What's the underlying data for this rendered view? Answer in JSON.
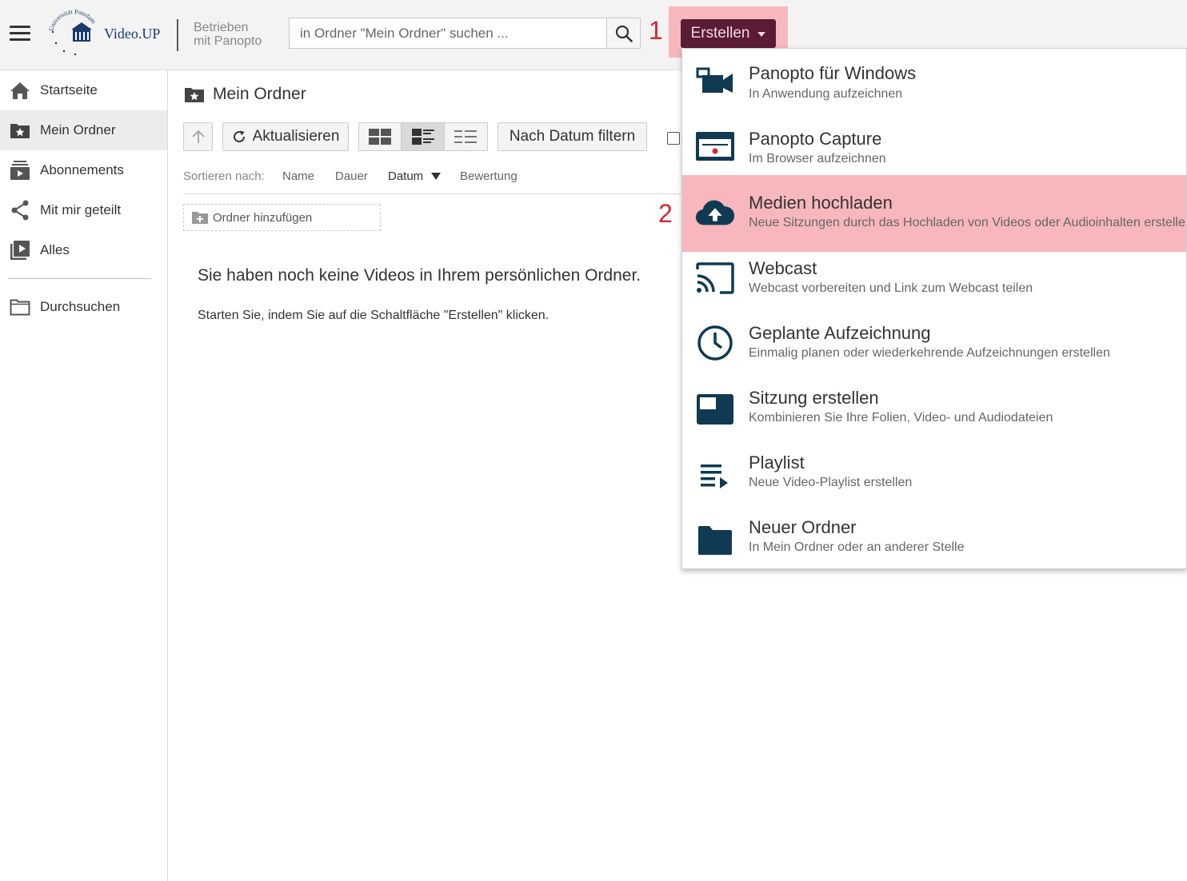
{
  "header": {
    "logo_text": "Video.UP",
    "logo_ring_text": "Universität Potsdam",
    "powered_line1": "Betrieben",
    "powered_line2": "mit Panopto",
    "search_placeholder": "in Ordner \"Mein Ordner\" suchen ...",
    "create_label": "Erstellen",
    "step1": "1",
    "step2": "2"
  },
  "sidebar": {
    "items": [
      {
        "label": "Startseite",
        "icon": "home-icon"
      },
      {
        "label": "Mein Ordner",
        "icon": "star-folder-icon",
        "active": true
      },
      {
        "label": "Abonnements",
        "icon": "subscriptions-icon"
      },
      {
        "label": "Mit mir geteilt",
        "icon": "share-icon"
      },
      {
        "label": "Alles",
        "icon": "video-library-icon"
      },
      {
        "label": "Durchsuchen",
        "icon": "folder-outline-icon"
      }
    ]
  },
  "main": {
    "folder_title": "Mein Ordner",
    "refresh_label": "Aktualisieren",
    "filter_label": "Nach Datum filtern",
    "sort_label": "Sortieren nach:",
    "sort_options": [
      "Name",
      "Dauer",
      "Datum",
      "Bewertung"
    ],
    "add_folder_label": "Ordner hinzufügen",
    "empty_title": "Sie haben noch keine Videos in Ihrem persönlichen Ordner.",
    "empty_sub": "Starten Sie, indem Sie auf die Schaltfläche \"Erstellen\" klicken."
  },
  "dropdown": {
    "items": [
      {
        "title": "Panopto für Windows",
        "sub": "In Anwendung aufzeichnen",
        "icon": "video-camera-icon"
      },
      {
        "title": "Panopto Capture",
        "sub": "Im Browser aufzeichnen",
        "icon": "browser-record-icon"
      },
      {
        "title": "Medien hochladen",
        "sub": "Neue Sitzungen durch das Hochladen von Videos oder Audioinhalten erstellen",
        "icon": "cloud-upload-icon"
      },
      {
        "title": "Webcast",
        "sub": "Webcast vorbereiten und Link zum Webcast teilen",
        "icon": "cast-icon"
      },
      {
        "title": "Geplante Aufzeichnung",
        "sub": "Einmalig planen oder wiederkehrende Aufzeichnungen erstellen",
        "icon": "clock-icon"
      },
      {
        "title": "Sitzung erstellen",
        "sub": "Kombinieren Sie Ihre Folien, Video- und Audiodateien",
        "icon": "session-icon"
      },
      {
        "title": "Playlist",
        "sub": "Neue Video-Playlist erstellen",
        "icon": "playlist-icon"
      },
      {
        "title": "Neuer Ordner",
        "sub": "In Mein Ordner oder an anderer Stelle",
        "icon": "folder-icon"
      }
    ]
  },
  "colors": {
    "brand_dark": "#5a1b35",
    "highlight": "#f7b7bc",
    "icon_navy": "#0f3a52",
    "step_red": "#d7262f"
  }
}
